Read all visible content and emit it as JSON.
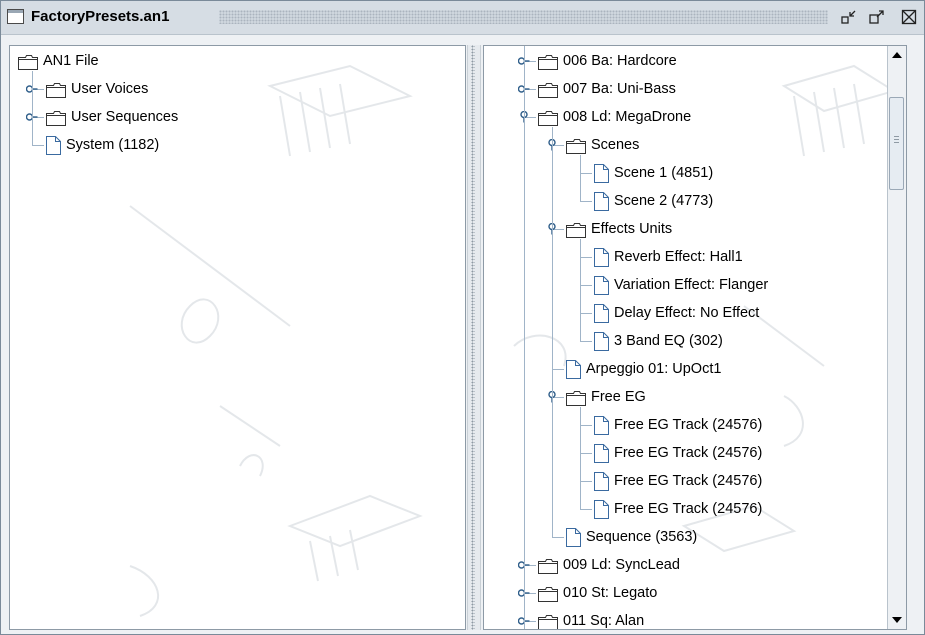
{
  "window": {
    "title": "FactoryPresets.an1",
    "buttons": [
      "minimize-icon",
      "maximize-icon",
      "close-icon"
    ]
  },
  "left_tree": [
    {
      "label": "AN1 File",
      "type": "folder",
      "depth": 0,
      "toggle": "none"
    },
    {
      "label": "User Voices",
      "type": "folder",
      "depth": 1,
      "toggle": "collapsed"
    },
    {
      "label": "User Sequences",
      "type": "folder",
      "depth": 1,
      "toggle": "collapsed"
    },
    {
      "label": "System (1182)",
      "type": "file",
      "depth": 1,
      "toggle": "none"
    }
  ],
  "right_tree": [
    {
      "label": "006  Ba: Hardcore",
      "type": "folder",
      "depth": 0,
      "toggle": "collapsed"
    },
    {
      "label": "007  Ba: Uni-Bass",
      "type": "folder",
      "depth": 0,
      "toggle": "collapsed"
    },
    {
      "label": "008  Ld: MegaDrone",
      "type": "folder",
      "depth": 0,
      "toggle": "expanded"
    },
    {
      "label": "Scenes",
      "type": "folder",
      "depth": 1,
      "toggle": "expanded"
    },
    {
      "label": "Scene 1 (4851)",
      "type": "file",
      "depth": 2,
      "toggle": "none"
    },
    {
      "label": "Scene 2 (4773)",
      "type": "file",
      "depth": 2,
      "toggle": "none"
    },
    {
      "label": "Effects Units",
      "type": "folder",
      "depth": 1,
      "toggle": "expanded"
    },
    {
      "label": "Reverb Effect: Hall1",
      "type": "file",
      "depth": 2,
      "toggle": "none"
    },
    {
      "label": "Variation Effect: Flanger",
      "type": "file",
      "depth": 2,
      "toggle": "none"
    },
    {
      "label": "Delay Effect: No Effect",
      "type": "file",
      "depth": 2,
      "toggle": "none"
    },
    {
      "label": "3 Band EQ (302)",
      "type": "file",
      "depth": 2,
      "toggle": "none"
    },
    {
      "label": "Arpeggio 01: UpOct1",
      "type": "file",
      "depth": 1,
      "toggle": "none"
    },
    {
      "label": "Free EG",
      "type": "folder",
      "depth": 1,
      "toggle": "expanded"
    },
    {
      "label": "Free EG Track (24576)",
      "type": "file",
      "depth": 2,
      "toggle": "none"
    },
    {
      "label": "Free EG Track (24576)",
      "type": "file",
      "depth": 2,
      "toggle": "none"
    },
    {
      "label": "Free EG Track (24576)",
      "type": "file",
      "depth": 2,
      "toggle": "none"
    },
    {
      "label": "Free EG Track (24576)",
      "type": "file",
      "depth": 2,
      "toggle": "none"
    },
    {
      "label": "Sequence  (3563)",
      "type": "file",
      "depth": 1,
      "toggle": "none"
    },
    {
      "label": "009  Ld: SyncLead",
      "type": "folder",
      "depth": 0,
      "toggle": "collapsed"
    },
    {
      "label": "010  St: Legato",
      "type": "folder",
      "depth": 0,
      "toggle": "collapsed"
    },
    {
      "label": "011  Sq: Alan",
      "type": "folder",
      "depth": 0,
      "toggle": "collapsed"
    }
  ],
  "scrollbar": {
    "position_fraction": 0.06,
    "visible_fraction": 0.17
  },
  "colors": {
    "tree_line": "#a0b4c8",
    "toggle": "#2f5e8a",
    "folder_edge": "#333333"
  }
}
